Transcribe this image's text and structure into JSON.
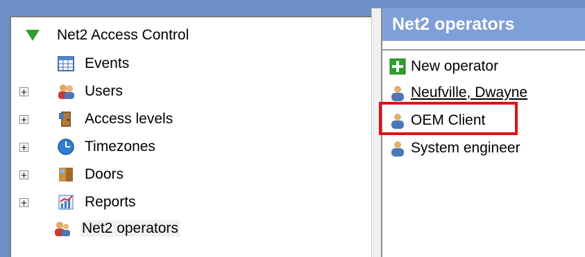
{
  "tree": {
    "root": {
      "label": "Net2 Access Control",
      "icon": "triangle-expanded-icon"
    },
    "items": [
      {
        "label": "Events",
        "icon": "events-grid-icon",
        "expandable": false
      },
      {
        "label": "Users",
        "icon": "users-icon",
        "expandable": true
      },
      {
        "label": "Access levels",
        "icon": "access-levels-icon",
        "expandable": true
      },
      {
        "label": "Timezones",
        "icon": "clock-icon",
        "expandable": true
      },
      {
        "label": "Doors",
        "icon": "doors-icon",
        "expandable": true
      },
      {
        "label": "Reports",
        "icon": "reports-icon",
        "expandable": true
      },
      {
        "label": "Net2 operators",
        "icon": "operators-icon",
        "expandable": false,
        "selected": true
      }
    ],
    "expander_glyph": "+"
  },
  "panel": {
    "title": "Net2 operators",
    "items": [
      {
        "label": "New operator",
        "icon": "add-icon"
      },
      {
        "label": "Neufville, Dwayne",
        "icon": "operator-icon"
      },
      {
        "label": "OEM Client",
        "icon": "operator-icon",
        "highlighted": true
      },
      {
        "label": "System engineer",
        "icon": "operator-icon"
      }
    ]
  },
  "colors": {
    "header_bg": "#7f9fd8",
    "highlight_border": "#e01010",
    "root_triangle": "#2f9e2f"
  }
}
